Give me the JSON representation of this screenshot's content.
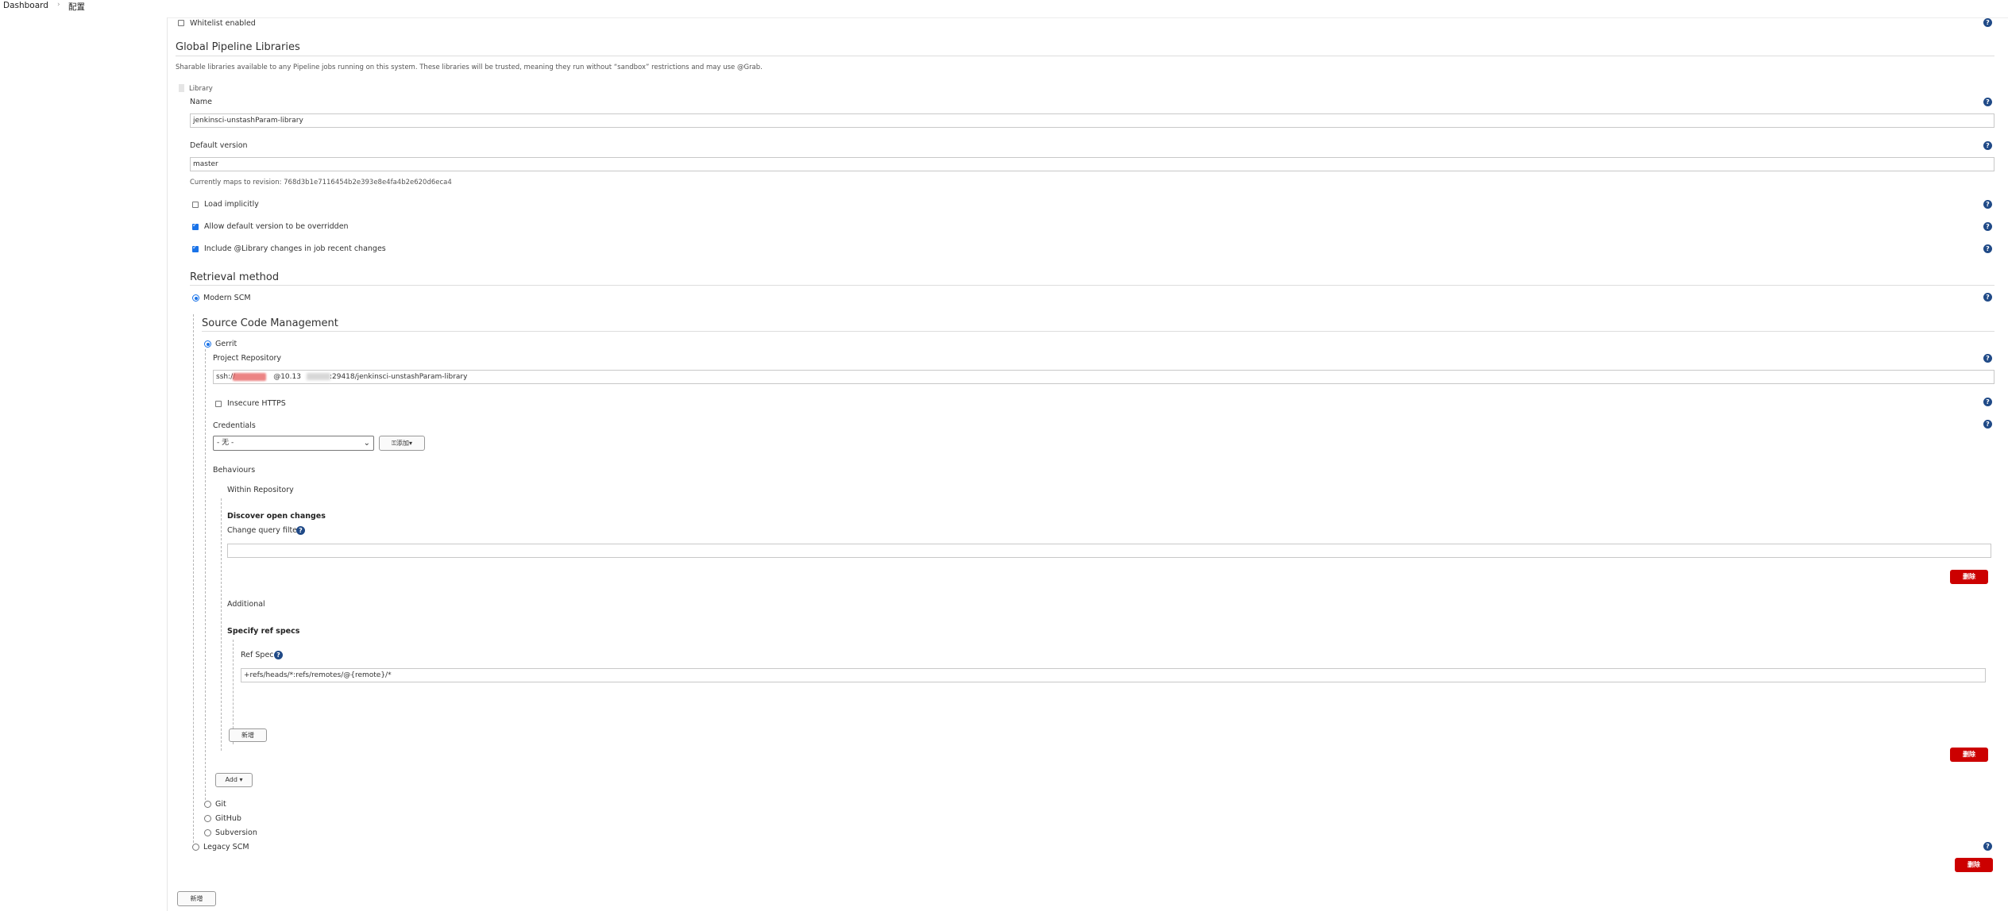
{
  "breadcrumb": {
    "home": "Dashboard",
    "separator": "›",
    "current": "配置"
  },
  "whitelist": {
    "label": "Whitelist enabled",
    "checked": false
  },
  "global_libraries": {
    "title": "Global Pipeline Libraries",
    "description": "Sharable libraries available to any Pipeline jobs running on this system. These libraries will be trusted, meaning they run without “sandbox” restrictions and may use @Grab.",
    "library_label": "Library",
    "name_label": "Name",
    "name_value": "jenkinsci-unstashParam-library",
    "default_version_label": "Default version",
    "default_version_value": "master",
    "revision_text": "Currently maps to revision: 768d3b1e7116454b2e393e8e4fa4b2e620d6eca4",
    "load_implicitly": {
      "label": "Load implicitly",
      "checked": false
    },
    "allow_override": {
      "label": "Allow default version to be overridden",
      "checked": true
    },
    "include_changes": {
      "label": "Include @Library changes in job recent changes",
      "checked": true
    }
  },
  "retrieval": {
    "title": "Retrieval method",
    "modern_scm": "Modern SCM",
    "legacy_scm": "Legacy SCM"
  },
  "scm": {
    "title": "Source Code Management",
    "gerrit": "Gerrit",
    "project_repo_label": "Project Repository",
    "project_repo_prefix": "ssh://",
    "project_repo_mid": "@10.13",
    "project_repo_suffix": ":29418/jenkinsci-unstashParam-library",
    "insecure_https": "Insecure HTTPS",
    "credentials_label": "Credentials",
    "credentials_value": "- 无 -",
    "add_cred_button": "添加",
    "add_cred_icon": "key-icon",
    "behaviours_label": "Behaviours",
    "within_repo": "Within Repository",
    "discover_title": "Discover open changes",
    "change_query_label": "Change query filter",
    "change_query_value": "",
    "delete_label": "删除",
    "additional": "Additional",
    "refspecs_title": "Specify ref specs",
    "ref_spec_label": "Ref Spec",
    "ref_spec_value": "+refs/heads/*:refs/remotes/@{remote}/*",
    "add_refspec_button": "新增",
    "add_button": "Add",
    "git": "Git",
    "github": "GitHub",
    "subversion": "Subversion"
  },
  "bottom_add_button": "新增",
  "help_icon": "?"
}
